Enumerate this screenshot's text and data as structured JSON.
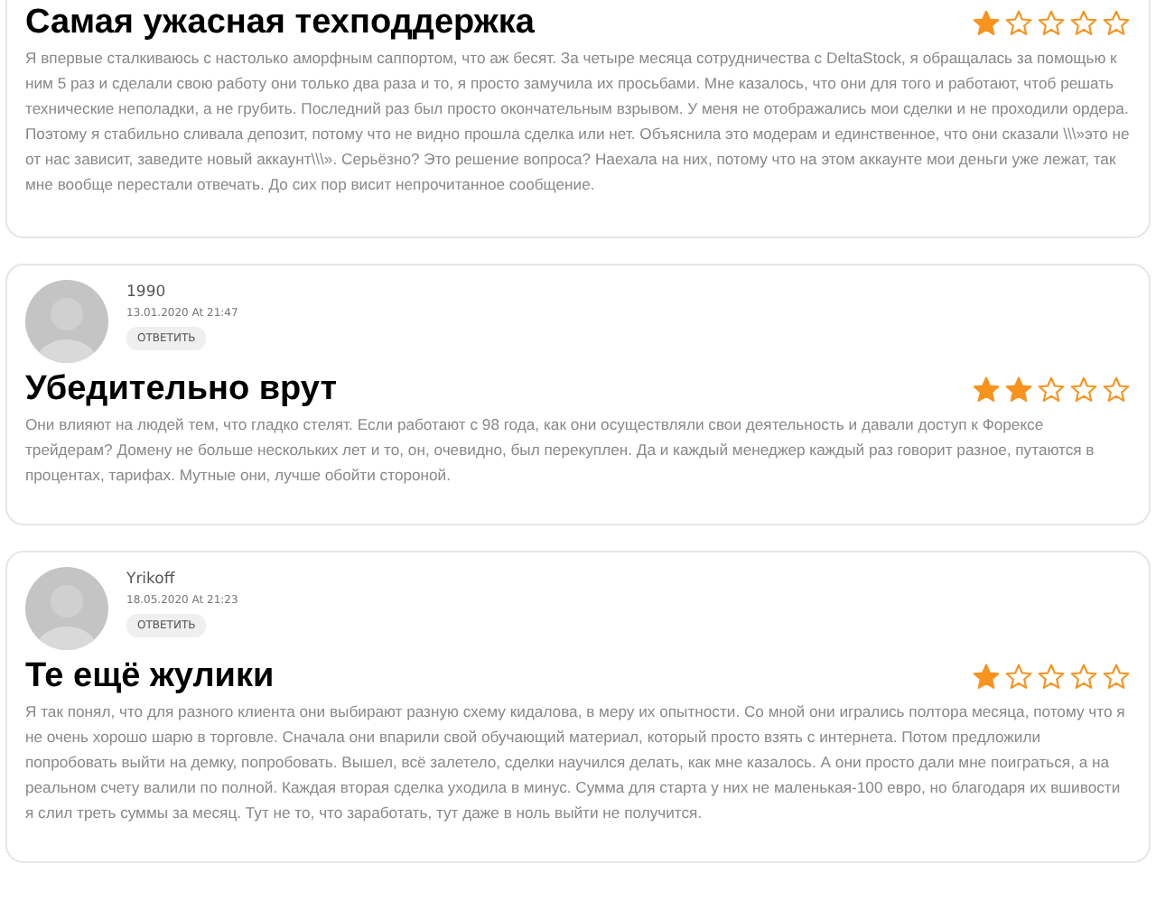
{
  "reviews": [
    {
      "title": "Самая ужасная техподдержка",
      "stars": 1,
      "text": "Я впервые сталкиваюсь с настолько аморфным саппортом, что аж бесят. За четыре месяца сотрудничества с DeltaStock, я обращалась за помощью к ним 5 раз и сделали свою работу они только два раза и то, я просто замучила их просьбами. Мне казалось, что они для того и работают, чтоб решать технические неполадки, а не грубить. Последний раз был просто окончательным взрывом. У меня не отображались мои сделки и не проходили ордера. Поэтому я стабильно сливала депозит, потому что не видно прошла сделка или нет. Объяснила это модерам и единственное, что они сказали \\\\\\»это не от нас зависит, заведите новый аккаунт\\\\\\». Серьёзно? Это решение вопроса? Наехала на них, потому что на этом аккаунте мои деньги уже лежат, так мне вообще перестали отвечать. До сих пор висит непрочитанное сообщение."
    },
    {
      "author": "1990",
      "date": "13.01.2020 At 21:47",
      "reply": "ОТВЕТИТЬ",
      "title": "Убедительно врут",
      "stars": 2,
      "text": "Они влияют на людей тем, что гладко стелят. Если работают с 98 года, как они осуществляли свои деятельность и давали доступ к Форексе трейдерам? Домену не больше нескольких лет и то, он, очевидно, был перекуплен. Да и каждый менеджер каждый раз говорит разное, путаются в процентах, тарифах. Мутные они, лучше обойти стороной."
    },
    {
      "author": "Yrikoff",
      "date": "18.05.2020 At 21:23",
      "reply": "ОТВЕТИТЬ",
      "title": "Те ещё жулики",
      "stars": 1,
      "text": "Я так понял, что для разного клиента они выбирают разную схему кидалова, в меру их опытности. Со мной они игрались полтора месяца, потому что я не очень хорошо шарю в торговле. Сначала они впарили свой обучающий материал, который просто взять с интернета. Потом предложили попробовать выйти на демку, попробовать. Вышел, всё залетело, сделки научился делать, как мне казалось. А они просто дали мне поиграться, а на реальном счету валили по полной. Каждая вторая сделка уходила в минус. Сумма для старта у них не маленькая-100 евро, но благодаря их вшивости я слил треть суммы за месяц. Тут не то, что заработать, тут даже в ноль выйти не получится."
    }
  ]
}
